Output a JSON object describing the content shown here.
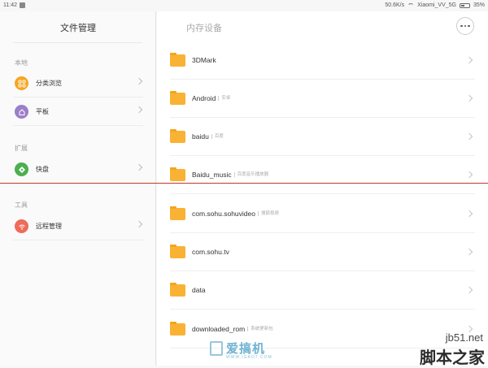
{
  "statusbar": {
    "time": "11:42",
    "speed": "50.6K/s",
    "network": "Xiaomi_VV_5G",
    "battery": "35%"
  },
  "sidebar": {
    "title": "文件管理",
    "sections": [
      {
        "label": "本地",
        "items": [
          {
            "label": "分类浏览",
            "icon": "category-grid-icon",
            "color": "#f5a623"
          },
          {
            "label": "平板",
            "icon": "home-tablet-icon",
            "color": "#9b7fc9"
          }
        ]
      },
      {
        "label": "扩展",
        "items": [
          {
            "label": "快盘",
            "icon": "kuaipan-icon",
            "color": "#4caf50"
          }
        ]
      },
      {
        "label": "工具",
        "items": [
          {
            "label": "远程管理",
            "icon": "wifi-remote-icon",
            "color": "#ef6b5a"
          }
        ]
      }
    ]
  },
  "main": {
    "title": "内存设备",
    "more_button": "more-icon",
    "folders": [
      {
        "name": "3DMark",
        "tag": ""
      },
      {
        "name": "Android",
        "tag": "安卓"
      },
      {
        "name": "baidu",
        "tag": "百度"
      },
      {
        "name": "Baidu_music",
        "tag": "百度音乐播放器"
      },
      {
        "name": "com.sohu.sohuvideo",
        "tag": "搜狐视频"
      },
      {
        "name": "com.sohu.tv",
        "tag": ""
      },
      {
        "name": "data",
        "tag": ""
      },
      {
        "name": "downloaded_rom",
        "tag": "系统更新包"
      }
    ]
  },
  "watermark": {
    "left_text": "爱搞机",
    "left_sub": "WWW.IGAO7.COM",
    "right_url": "jb51.net",
    "right_text": "脚本之家"
  },
  "colors": {
    "folder": "#f9b233",
    "divider_red": "#c0392b"
  }
}
